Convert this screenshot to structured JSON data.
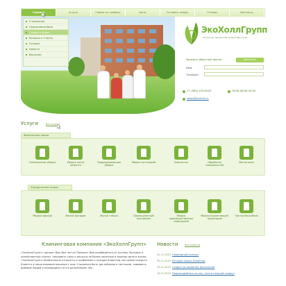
{
  "nav": {
    "items": [
      "Главная",
      "Услуги",
      "Сервис по графику",
      "Цены",
      "Оставить заявку",
      "Отзывы",
      "Контакты"
    ]
  },
  "menu": {
    "items": [
      "О компании",
      "Нормативная база",
      "Скидки и Акции",
      "Вопросы и Ответы",
      "Галерея",
      "Новости",
      "Вакансии"
    ]
  },
  "logo": {
    "name": "ЭкоХоллГрупп",
    "tagline": "Чистые мы сделаем! Мы делаем Ваш уход!"
  },
  "callback": {
    "title": "Заказать обратный звонок:",
    "button": "Заказать!",
    "name_label": "Имя:",
    "phone_label": "Телефон:"
  },
  "contacts": {
    "phone": "+7 (495) 123-45-67",
    "hours": "Пн-Вс 08:00-22:00",
    "email": "zakaz@ecoholl.ru"
  },
  "services": {
    "title": "Услуги",
    "all_link": "Все услуги",
    "phys_tab": "Физическим лицам",
    "phys": [
      "Генеральные уборка",
      "Уборка после ремонта",
      "Поддерживающая уборка",
      "Уборка коттеджей",
      "Химчистка",
      "Обработка поверхностей",
      "Мытьё окон"
    ],
    "legal_tab": "Юридическим лицам",
    "legal": [
      "Уборка офисов",
      "Мытьё фасадов",
      "Мытьё стёкол",
      "Промышленный альпинизм",
      "Уборка производственных помещений",
      "Уборка прилегающей территории",
      "Чистка бассейнов"
    ]
  },
  "about": {
    "title": "Клининговая компания «ЭкоХоллГрупп»",
    "text": "«ЭкоХоллГрупп» сделает Ваш быт легче! Поможет Вам освободиться от рутины, бытовых и хозяйственных хлопот, направить силы и ресурсы на более полезные и важные дела в жизни. «ЭкоХоллГрупп» внимательно относится к проблемам и нуждам Клиентов, мы ценим каждого Клиента и наши взаимоотношения с ним. Стараемся быть достойными и честными, завоевать доверие людей и оправдывать его в дальнейшем. Мы"
  },
  "news": {
    "title": "Новости",
    "all_link": "все новости",
    "items": [
      {
        "date": "01.11.2015",
        "title": "Новогодний конкурс"
      },
      {
        "date": "30.11.2015",
        "title": "Истории наших Клиентов"
      },
      {
        "date": "29.11.2015",
        "title": "Скидка на семейные фотосессии"
      },
      {
        "date": "19.11.2015",
        "title": "Подписывайтесь на нас, сети и получай скидку!"
      }
    ]
  },
  "colors": {
    "accent": "#8fc245",
    "text_green": "#4a7a1f",
    "link": "#2f6ea5",
    "panel_bg": "#eef6df"
  }
}
